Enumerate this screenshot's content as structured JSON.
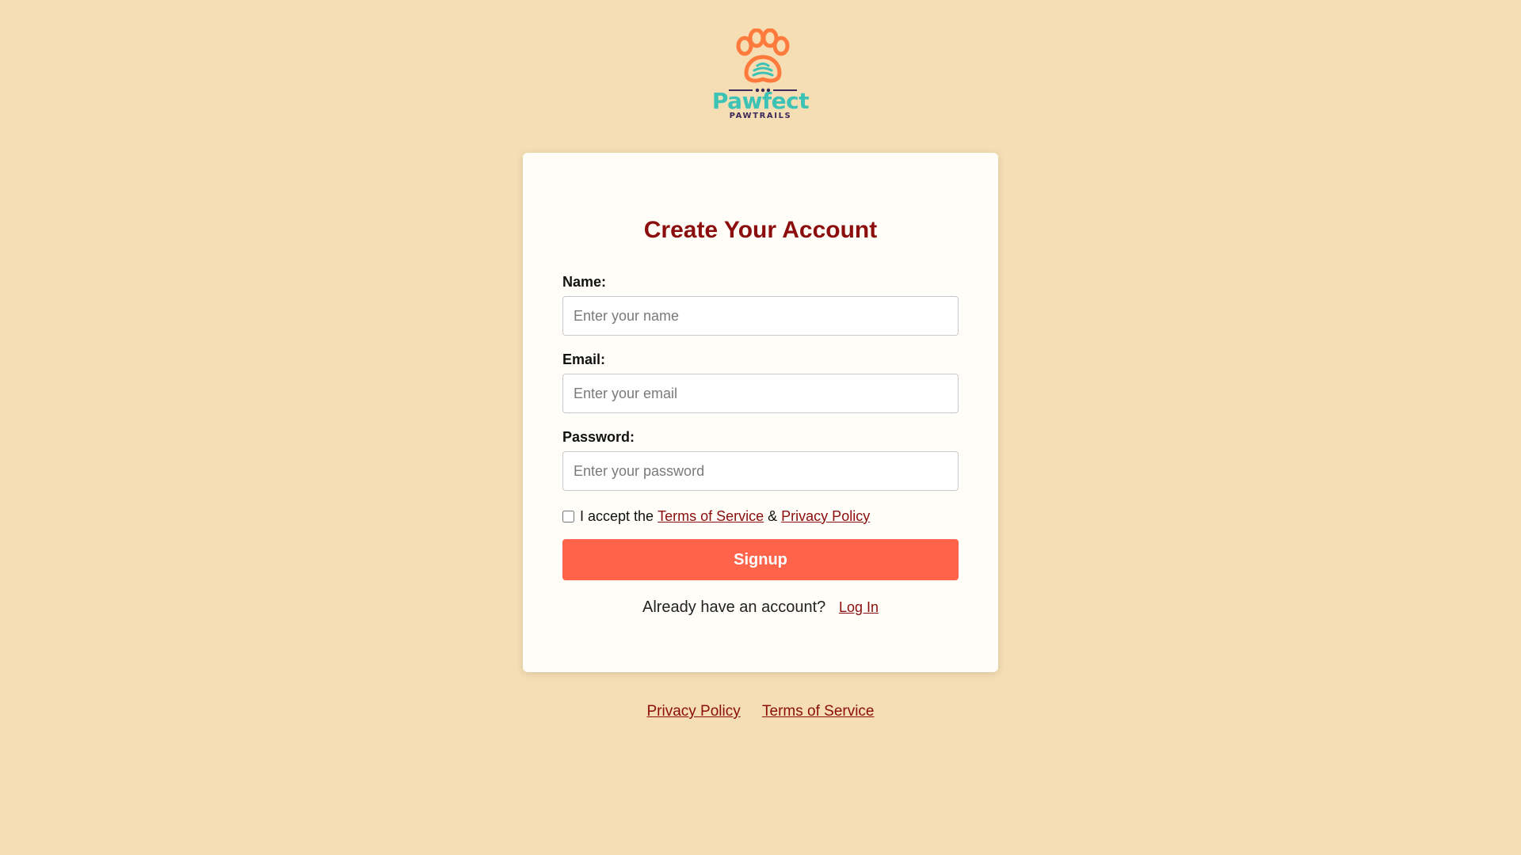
{
  "brand": {
    "name": "Pawfect",
    "tagline": "PAWTRAILS",
    "colors": {
      "paw": "#ff7a3d",
      "title": "#3cc3b5",
      "tagline": "#3b2a5a"
    }
  },
  "form": {
    "title": "Create Your Account",
    "name_label": "Name:",
    "name_placeholder": "Enter your name",
    "email_label": "Email:",
    "email_placeholder": "Enter your email",
    "password_label": "Password:",
    "password_placeholder": "Enter your password",
    "accept_prefix": "I accept the",
    "terms_link": "Terms of Service",
    "ampersand": "&",
    "privacy_link": "Privacy Policy",
    "accept_checked": false,
    "submit_label": "Signup",
    "login_prompt": "Already have an account?",
    "login_link": "Log In"
  },
  "footer": {
    "privacy_link": "Privacy Policy",
    "terms_link": "Terms of Service"
  },
  "theme": {
    "background": "#f5deb3",
    "card": "#fffdf7",
    "accent": "#8b0d0d",
    "button": "#ff634a"
  }
}
